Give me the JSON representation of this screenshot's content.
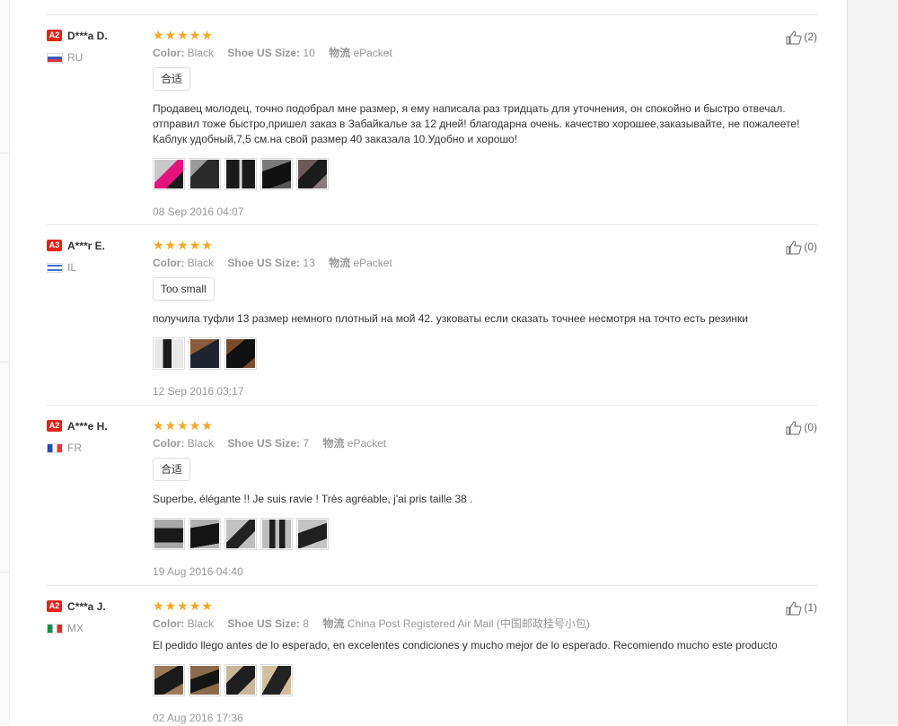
{
  "reviews": [
    {
      "level": "A2",
      "name": "D***a D.",
      "country": "RU",
      "color_label": "Color:",
      "color_value": "Black",
      "size_label": "Shoe US Size:",
      "size_value": "10",
      "ship_label": "物流",
      "ship_value": "ePacket",
      "tag": "合适",
      "text": "Продавец молодец, точно подобрал мне размер, я ему написала раз тридцать для уточнения, он спокойно и быстро отвечал. отправил тоже быстро,пришел заказ в Забайкалье за 12 дней! благодарна очень. качество хорошее,заказывайте, не пожалеете! Каблук удобный,7,5 см.на свой размер 40 заказала 10.Удобно и хорошо!",
      "date": "08 Sep 2016 04:07",
      "useful": "(2)",
      "photos": [
        {
          "icon": "shoe-photo",
          "c1": "#c8c8c8",
          "c2": "#e3147f"
        },
        {
          "icon": "shoe-photo",
          "c1": "#2a2a2a",
          "c2": "#9a9a9a"
        },
        {
          "icon": "shoe-photo",
          "c1": "#1a1a1a",
          "c2": "#d9d9d9"
        },
        {
          "icon": "shoe-photo",
          "c1": "#111111",
          "c2": "#7a7a7a"
        },
        {
          "icon": "shoe-photo",
          "c1": "#6b5a5a",
          "c2": "#1b1b1b"
        }
      ]
    },
    {
      "level": "A3",
      "name": "A***r E.",
      "country": "IL",
      "color_label": "Color:",
      "color_value": "Black",
      "size_label": "Shoe US Size:",
      "size_value": "13",
      "ship_label": "物流",
      "ship_value": "ePacket",
      "tag": "Too small",
      "text": "получила туфли 13 размер немного плотный на мой 42. узковаты если сказать точнее несмотря на точто есть резинки",
      "date": "12 Sep 2016 03:17",
      "useful": "(0)",
      "photos": [
        {
          "icon": "shoe-photo",
          "c1": "#e8e8e8",
          "c2": "#1a1a1a"
        },
        {
          "icon": "shoe-photo",
          "c1": "#8a5a3a",
          "c2": "#1f2430"
        },
        {
          "icon": "shoe-photo",
          "c1": "#7a4a2a",
          "c2": "#111111"
        }
      ]
    },
    {
      "level": "A2",
      "name": "A***e H.",
      "country": "FR",
      "color_label": "Color:",
      "color_value": "Black",
      "size_label": "Shoe US Size:",
      "size_value": "7",
      "ship_label": "物流",
      "ship_value": "ePacket",
      "tag": "合适",
      "text": "Superbe, élégante !! Je suis ravie ! Très agréable, j'ai pris taille 38 .",
      "date": "19 Aug 2016 04:40",
      "useful": "(0)",
      "photos": [
        {
          "icon": "shoe-photo",
          "c1": "#a8a8a8",
          "c2": "#1a1a1a"
        },
        {
          "icon": "shoe-photo",
          "c1": "#b0b0b0",
          "c2": "#151515"
        },
        {
          "icon": "shoe-photo",
          "c1": "#c0c0c0",
          "c2": "#222222"
        },
        {
          "icon": "shoe-photo",
          "c1": "#bdbdbd",
          "c2": "#1e1e1e"
        },
        {
          "icon": "shoe-photo",
          "c1": "#c4c4c4",
          "c2": "#202020"
        }
      ]
    },
    {
      "level": "A2",
      "name": "C***a J.",
      "country": "MX",
      "color_label": "Color:",
      "color_value": "Black",
      "size_label": "Shoe US Size:",
      "size_value": "8",
      "ship_label": "物流",
      "ship_value": "China Post Registered Air Mail (中国邮政挂号小包)",
      "tag": "",
      "text": "El pedido llego antes de lo esperado, en excelentes condiciones y mucho mejor de lo esperado. Recomiendo mucho este producto",
      "date": "02 Aug 2016 17:36",
      "useful": "(1)",
      "photos": [
        {
          "icon": "shoe-photo",
          "c1": "#9a7a5a",
          "c2": "#1a1a1a"
        },
        {
          "icon": "shoe-photo",
          "c1": "#8a6a4a",
          "c2": "#151515"
        },
        {
          "icon": "shoe-photo",
          "c1": "#c8b89a",
          "c2": "#1e1e1e"
        },
        {
          "icon": "shoe-photo",
          "c1": "#d0c0a0",
          "c2": "#222222"
        }
      ]
    }
  ],
  "colors": {
    "star": "#f5a623",
    "badge": "#e1251b",
    "muted": "#999999"
  }
}
